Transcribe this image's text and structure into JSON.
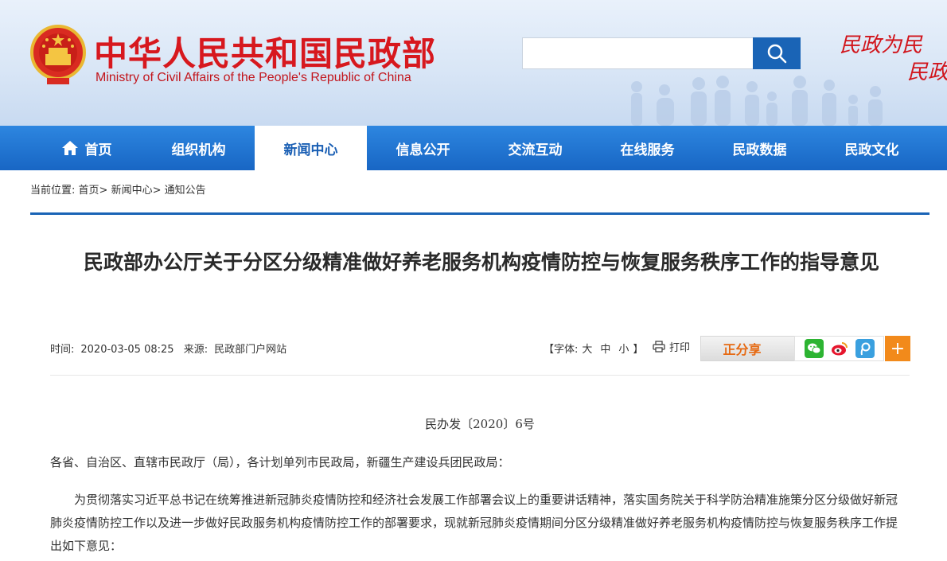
{
  "header": {
    "site_title_cn": "中华人民共和国民政部",
    "site_title_en": "Ministry of Civil Affairs of the People's Republic of China",
    "search_placeholder": "",
    "slogan_line1": "民政为民",
    "slogan_line2": "民政"
  },
  "nav": {
    "items": [
      {
        "label": "首页"
      },
      {
        "label": "组织机构"
      },
      {
        "label": "新闻中心"
      },
      {
        "label": "信息公开"
      },
      {
        "label": "交流互动"
      },
      {
        "label": "在线服务"
      },
      {
        "label": "民政数据"
      },
      {
        "label": "民政文化"
      }
    ],
    "active": "新闻中心"
  },
  "breadcrumb": {
    "prefix": "当前位置:",
    "items": [
      "首页",
      "新闻中心",
      "通知公告"
    ],
    "separator": ">"
  },
  "article": {
    "title": "民政部办公厅关于分区分级精准做好养老服务机构疫情防控与恢复服务秩序工作的指导意见",
    "time_label": "时间:",
    "time": "2020-03-05 08:25",
    "source_label": "来源:",
    "source": "民政部门户网站",
    "font_ctrl_open": "【字体:",
    "font_large": "大",
    "font_medium": "中",
    "font_small": "小",
    "font_ctrl_close": "】",
    "print_label": "打印",
    "share_label": "正分享",
    "doc_number": "民办发〔2020〕6号",
    "addressee": "各省、自治区、直辖市民政厅（局），各计划单列市民政局，新疆生产建设兵团民政局：",
    "paragraph1": "为贯彻落实习近平总书记在统筹推进新冠肺炎疫情防控和经济社会发展工作部署会议上的重要讲话精神，落实国务院关于科学防治精准施策分区分级做好新冠肺炎疫情防控工作以及进一步做好民政服务机构疫情防控工作的部署要求，现就新冠肺炎疫情期间分区分级精准做好养老服务机构疫情防控与恢复服务秩序工作提出如下意见："
  },
  "colors": {
    "brand_red": "#d7181e",
    "nav_blue": "#1866c4",
    "accent_orange": "#f28a1b"
  },
  "icons": {
    "search": "search-icon",
    "home": "home-icon",
    "print": "printer-icon",
    "wechat": "wechat-icon",
    "weibo": "weibo-icon",
    "tencent_weibo": "tencent-weibo-icon",
    "plus": "plus-icon"
  }
}
